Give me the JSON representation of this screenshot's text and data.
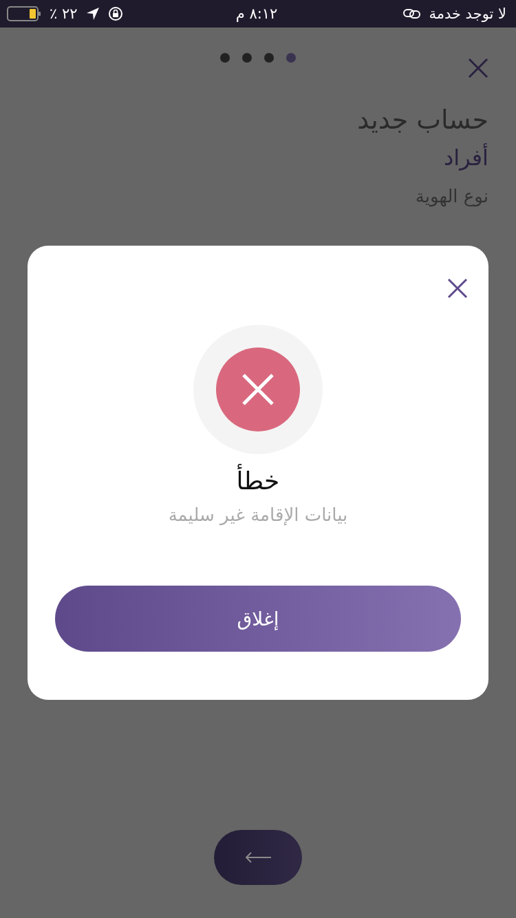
{
  "status_bar": {
    "carrier": "لا توجد خدمة",
    "time": "٨:١٢ م",
    "battery_text": "٢٢ ٪"
  },
  "steps": [
    {
      "selected": true
    },
    {
      "selected": false
    },
    {
      "selected": false
    },
    {
      "selected": false
    }
  ],
  "page": {
    "title": "حساب جديد",
    "subtitle": "أفراد",
    "field_label": "نوع الهوية"
  },
  "dialog": {
    "title": "خطأ",
    "message": "بيانات الإقامة غير سليمة",
    "button": "إغلاق"
  }
}
